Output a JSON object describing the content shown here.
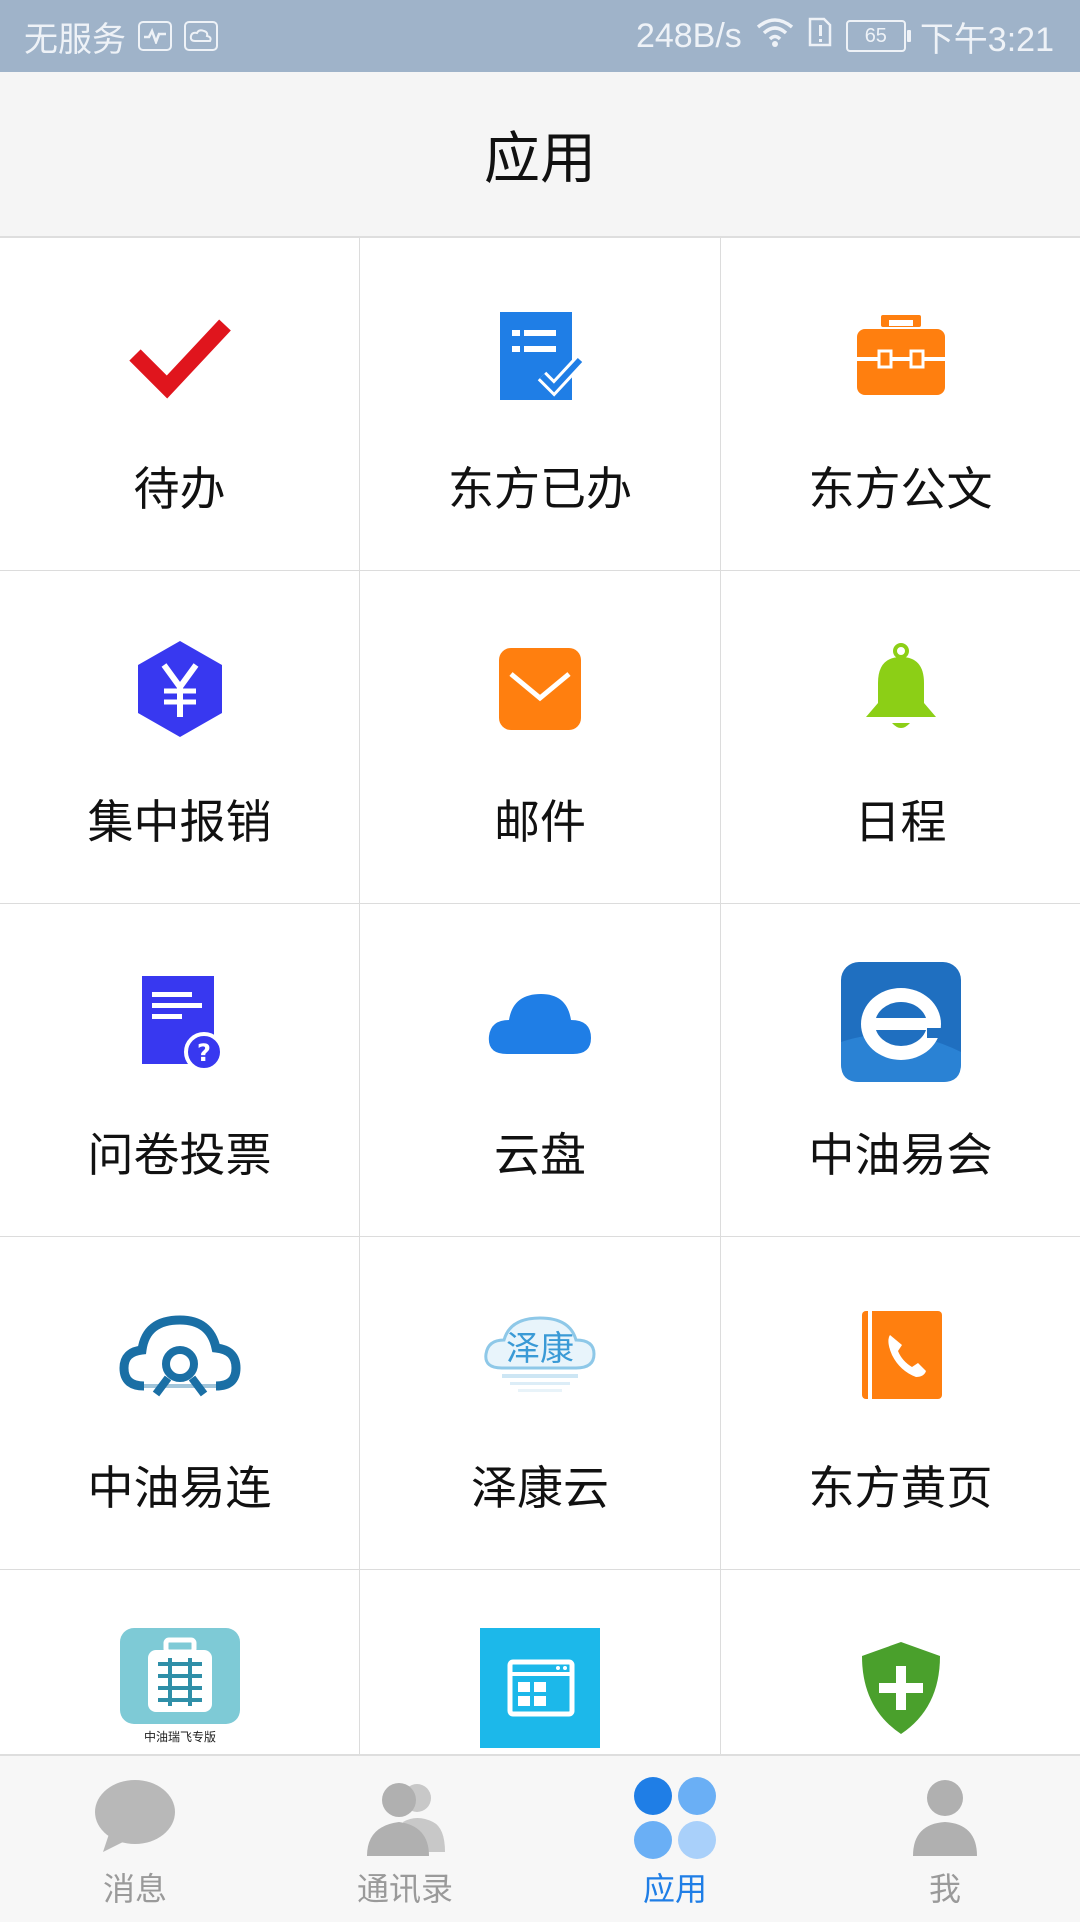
{
  "status_bar": {
    "carrier": "无服务",
    "speed": "248B/s",
    "battery": "65",
    "time": "下午3:21"
  },
  "header": {
    "title": "应用"
  },
  "apps": [
    {
      "label": "待办",
      "icon": "checkmark-icon"
    },
    {
      "label": "东方已办",
      "icon": "done-list-icon"
    },
    {
      "label": "东方公文",
      "icon": "briefcase-icon"
    },
    {
      "label": "集中报销",
      "icon": "yen-hexagon-icon"
    },
    {
      "label": "邮件",
      "icon": "envelope-icon"
    },
    {
      "label": "日程",
      "icon": "bell-icon"
    },
    {
      "label": "问卷投票",
      "icon": "survey-doc-icon"
    },
    {
      "label": "云盘",
      "icon": "cloud-icon"
    },
    {
      "label": "中油易会",
      "icon": "yihui-logo-icon"
    },
    {
      "label": "中油易连",
      "icon": "yilian-cloud-icon"
    },
    {
      "label": "泽康云",
      "icon": "zekang-cloud-icon",
      "logo_text": "泽康"
    },
    {
      "label": "东方黄页",
      "icon": "phonebook-icon"
    },
    {
      "label": "",
      "icon": "ruifei-app-icon",
      "logo_text": "中油瑞飞专版"
    },
    {
      "label": "",
      "icon": "app-window-icon"
    },
    {
      "label": "",
      "icon": "shield-plus-icon"
    }
  ],
  "tabs": [
    {
      "label": "消息",
      "icon": "chat-bubble-icon",
      "active": false
    },
    {
      "label": "通讯录",
      "icon": "contacts-icon",
      "active": false
    },
    {
      "label": "应用",
      "icon": "apps-grid-icon",
      "active": true
    },
    {
      "label": "我",
      "icon": "person-icon",
      "active": false
    }
  ],
  "colors": {
    "status_bar_bg": "#9fb3c9",
    "accent_blue": "#1f7ee6",
    "red": "#e0151d",
    "orange": "#ff7f0f",
    "green": "#8ccf16",
    "indigo": "#3838f0"
  }
}
